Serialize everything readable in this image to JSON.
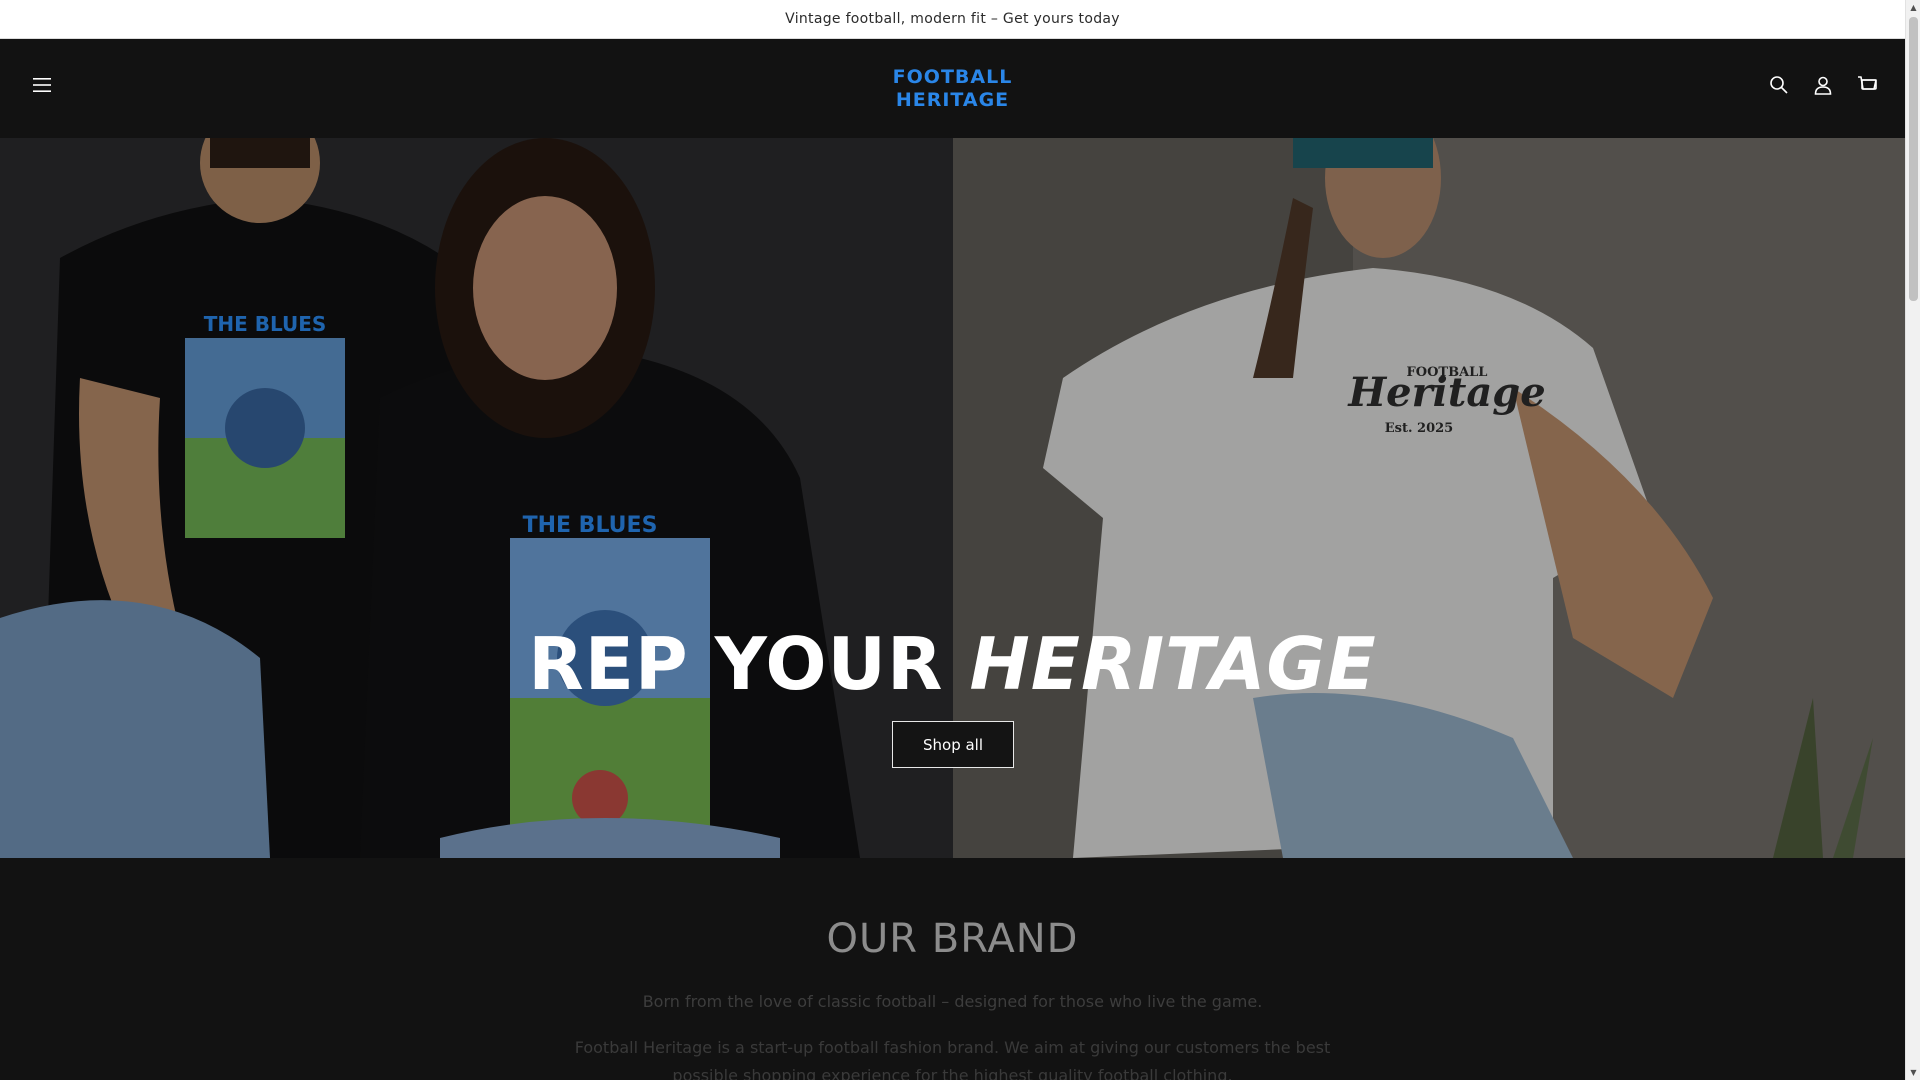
{
  "announcement": {
    "text": "Vintage football, modern fit – Get yours today"
  },
  "header": {
    "logo_line1": "FOOTBALL",
    "logo_line2": "HERITAGE",
    "icons": [
      "menu-icon",
      "search-icon",
      "account-icon",
      "cart-icon"
    ]
  },
  "hero": {
    "title_plain": "REP YOUR ",
    "title_emphasis": "HERITAGE",
    "button_label": "Shop all",
    "left_shirt_text_top": "THE BLUES",
    "left_shirt_text_bottom": "THE BLUES",
    "right_shirt_small": "FOOTBALL",
    "right_shirt_script": "Heritage",
    "right_shirt_est": "Est. 2025"
  },
  "brand": {
    "heading": "OUR BRAND",
    "subheading": "Born from the love of classic football – designed for those who live the game.",
    "body": "Football Heritage is a start-up football fashion brand. We aim at giving our customers the best possible shopping experience for the highest quality football clothing."
  },
  "colors": {
    "logo_blue": "#2a86e8",
    "header_bg": "#121212",
    "announcement_bg": "#ffffff"
  }
}
